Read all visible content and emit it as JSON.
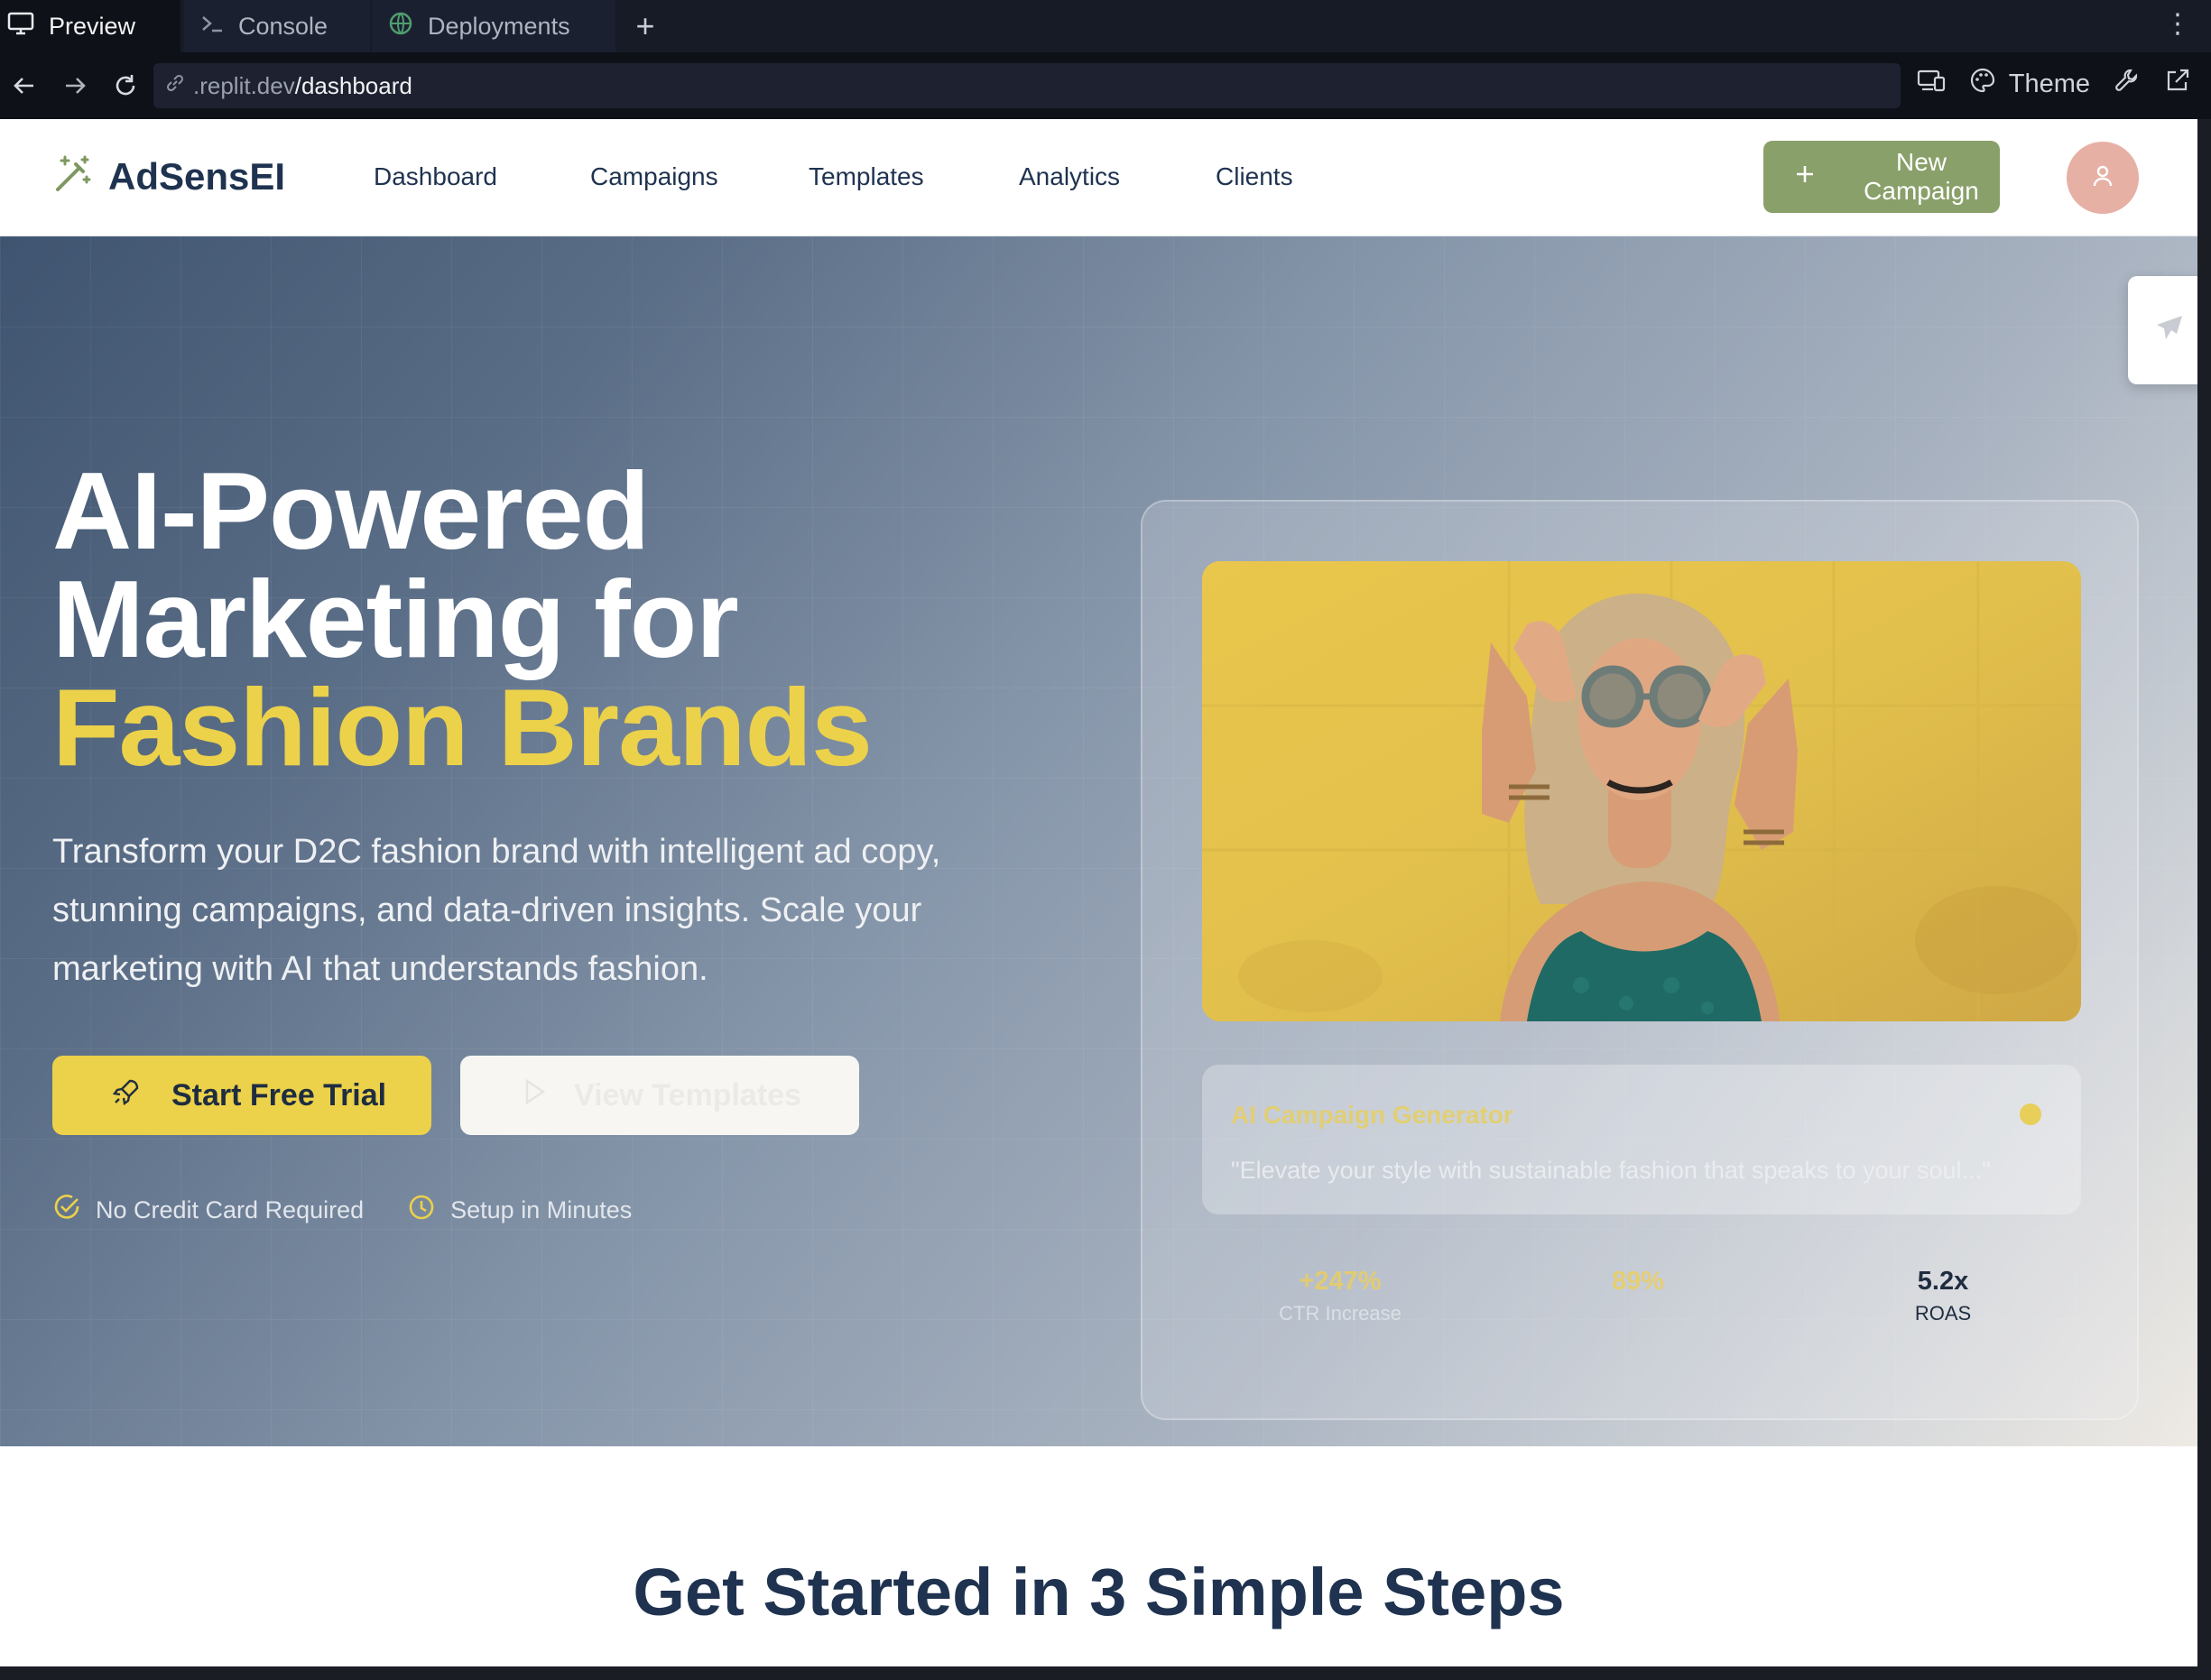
{
  "browser": {
    "tabs": [
      {
        "label": "Preview",
        "icon": "monitor-icon"
      },
      {
        "label": "Console",
        "icon": "terminal-icon"
      },
      {
        "label": "Deployments",
        "icon": "globe-icon"
      }
    ],
    "new_tab": "+",
    "url": {
      "host": ".replit.dev",
      "path": "/dashboard"
    },
    "theme_label": "Theme"
  },
  "header": {
    "brand": "AdSensEI",
    "nav": [
      "Dashboard",
      "Campaigns",
      "Templates",
      "Analytics",
      "Clients"
    ],
    "new_campaign_label": "New Campaign"
  },
  "hero": {
    "title_line1": "AI-Powered",
    "title_line2": "Marketing for",
    "title_accent": "Fashion Brands",
    "subtitle": "Transform your D2C fashion brand with intelligent ad copy, stunning campaigns, and data-driven insights. Scale your marketing with AI that understands fashion.",
    "primary_cta": "Start Free Trial",
    "secondary_cta": "View Templates",
    "perks": [
      "No Credit Card Required",
      "Setup in Minutes"
    ]
  },
  "card": {
    "generator_title": "AI Campaign Generator",
    "generator_quote": "\"Elevate your style with sustainable fashion that speaks to your soul...\"",
    "stats": [
      {
        "value": "+247%",
        "label": "CTR Increase"
      },
      {
        "value": "89%",
        "label": ""
      },
      {
        "value": "5.2x",
        "label": "ROAS"
      }
    ]
  },
  "steps": {
    "title": "Get Started in 3 Simple Steps"
  },
  "colors": {
    "accent_yellow": "#ecd14a",
    "brand_navy": "#1f3350",
    "campaign_green": "#8aa06a"
  }
}
